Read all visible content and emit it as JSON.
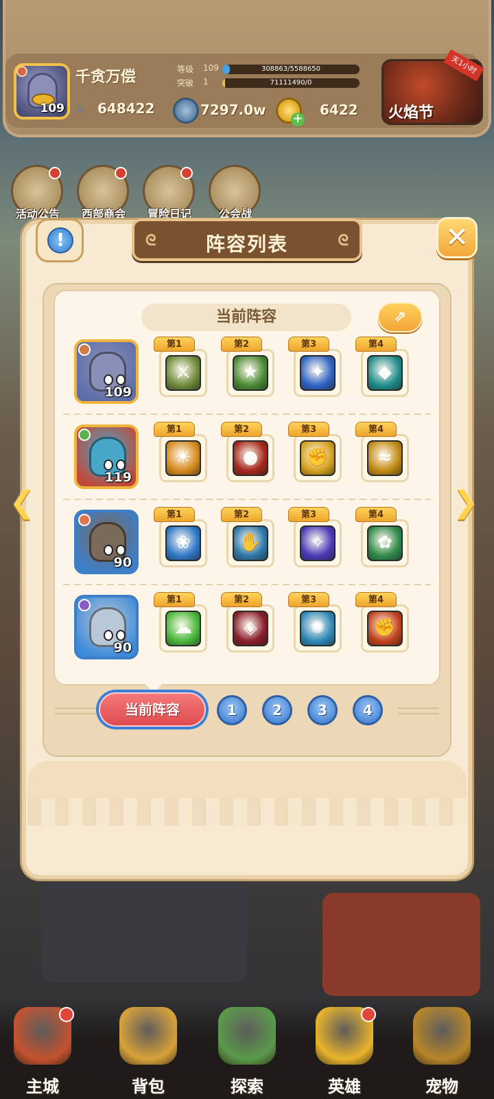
{
  "hud": {
    "player_name": "千贪万偿",
    "player_level": "109",
    "power": "648422",
    "level_label": "等级",
    "level_value": "109",
    "level_progress_text": "308863/5588650",
    "level_progress": 0.055,
    "break_label": "突破",
    "break_value": "1",
    "break_progress_text": "71111490/0",
    "break_progress": 0.02,
    "silver": "7297.0w",
    "gold": "6422",
    "event_name": "火焰节",
    "event_tag": "天1小时"
  },
  "shortcuts": [
    {
      "label": "活动公告",
      "icon": "scroll-icon"
    },
    {
      "label": "西部商会",
      "icon": "merchant-icon"
    },
    {
      "label": "冒险日记",
      "icon": "diary-icon"
    },
    {
      "label": "公会战",
      "icon": "guild-shield-icon"
    }
  ],
  "modal": {
    "title": "阵容列表",
    "current_label": "当前阵容",
    "info_glyph": "!",
    "close_glyph": "✕",
    "share_glyph": "⇗",
    "tabs": {
      "current": "当前阵容",
      "pages": [
        "1",
        "2",
        "3",
        "4"
      ]
    },
    "heroes": [
      {
        "level": "109",
        "colors": {
          "bg": "#5e6ea8",
          "face": "#8a8fb8",
          "frame": "#f0b43a",
          "elem": "#d07a4a"
        },
        "skills": [
          {
            "tag": "第1",
            "color": "#6e8a3a",
            "sym": "⚔"
          },
          {
            "tag": "第2",
            "color": "#4a8a34",
            "sym": "★"
          },
          {
            "tag": "第3",
            "color": "#2f63c4",
            "sym": "✦"
          },
          {
            "tag": "第4",
            "color": "#1f8c8c",
            "sym": "◆"
          }
        ]
      },
      {
        "level": "119",
        "colors": {
          "bg": "#c04a3a",
          "face": "#48a6c8",
          "frame": "#f0b43a",
          "elem": "#5bb34a"
        },
        "skills": [
          {
            "tag": "第1",
            "color": "#d58a1e",
            "sym": "☀"
          },
          {
            "tag": "第2",
            "color": "#a5281d",
            "sym": "●"
          },
          {
            "tag": "第3",
            "color": "#d5a21e",
            "sym": "✊"
          },
          {
            "tag": "第4",
            "color": "#c28a14",
            "sym": "≈"
          }
        ]
      },
      {
        "level": "90",
        "colors": {
          "bg": "#3d7ec8",
          "face": "#7a6a5a",
          "frame": "#3d7ec8",
          "elem": "#e0754a"
        },
        "skills": [
          {
            "tag": "第1",
            "color": "#2f78c8",
            "sym": "❀"
          },
          {
            "tag": "第2",
            "color": "#2f78a8",
            "sym": "✋"
          },
          {
            "tag": "第3",
            "color": "#4a3ab8",
            "sym": "✧"
          },
          {
            "tag": "第4",
            "color": "#2f8a4a",
            "sym": "✿"
          }
        ]
      },
      {
        "level": "90",
        "colors": {
          "bg": "#3d8ad8",
          "face": "#b8c8d8",
          "frame": "#3d7ec8",
          "elem": "#8a5ac8"
        },
        "skills": [
          {
            "tag": "第1",
            "color": "#4ab83a",
            "sym": "☁"
          },
          {
            "tag": "第2",
            "color": "#8a1e2a",
            "sym": "◈"
          },
          {
            "tag": "第3",
            "color": "#2f8ab8",
            "sym": "✺"
          },
          {
            "tag": "第4",
            "color": "#c2431e",
            "sym": "✊"
          }
        ]
      }
    ]
  },
  "bottom_nav": [
    {
      "label": "主城",
      "icon": "castle-icon",
      "color": "#c4522f",
      "badge": true
    },
    {
      "label": "背包",
      "icon": "backpack-icon",
      "color": "#d8a23a",
      "badge": false
    },
    {
      "label": "探索",
      "icon": "map-icon",
      "color": "#5a9a4a",
      "badge": false
    },
    {
      "label": "英雄",
      "icon": "hero-icon",
      "color": "#e8b42b",
      "badge": true
    },
    {
      "label": "宠物",
      "icon": "pet-icon",
      "color": "#b8862a",
      "badge": false
    }
  ]
}
